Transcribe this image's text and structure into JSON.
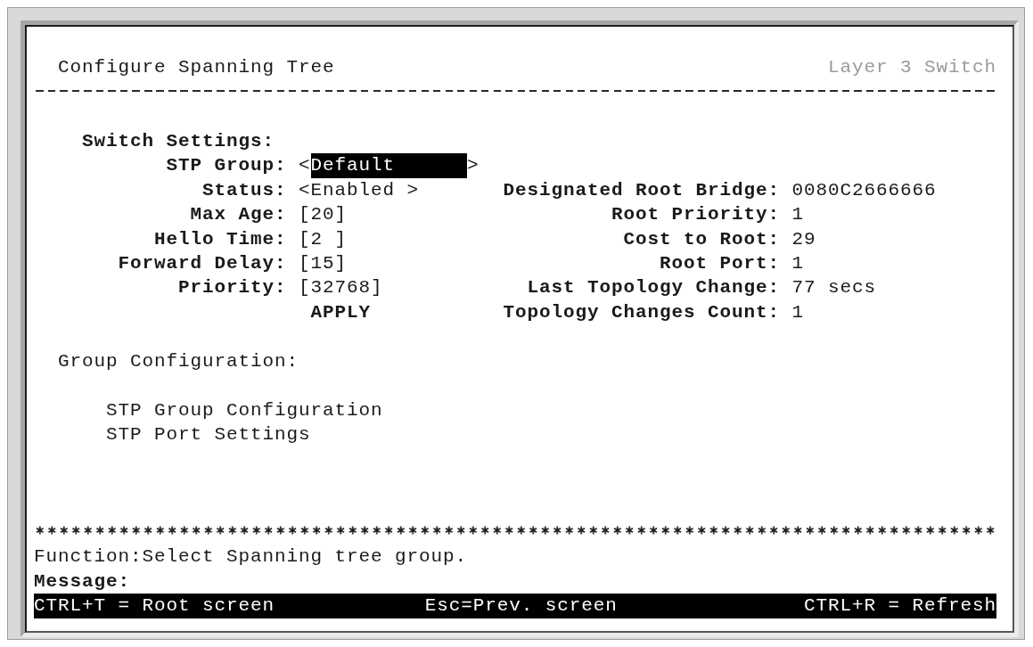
{
  "header": {
    "title": "Configure Spanning Tree",
    "device": "Layer 3 Switch"
  },
  "switch_settings": {
    "heading": "Switch Settings:",
    "fields": [
      {
        "label": "STP Group:",
        "kind": "select",
        "open": "<",
        "value": "Default",
        "close": ">",
        "focused": true
      },
      {
        "label": "Status:",
        "kind": "select",
        "open": "<",
        "value": "Enabled",
        "close": ">",
        "focused": false
      },
      {
        "label": "Max Age:",
        "kind": "input",
        "open": "[",
        "value": "20",
        "close": "]",
        "focused": false
      },
      {
        "label": "Hello Time:",
        "kind": "input",
        "open": "[",
        "value": "2",
        "close": "]",
        "focused": false
      },
      {
        "label": "Forward Delay:",
        "kind": "input",
        "open": "[",
        "value": "15",
        "close": "]",
        "focused": false
      },
      {
        "label": "Priority:",
        "kind": "input",
        "open": "[",
        "value": "32768",
        "close": "]",
        "focused": false
      }
    ],
    "apply_button": "APPLY"
  },
  "bridge_status": [
    {
      "label": "Designated Root Bridge:",
      "value": "0080C2666666"
    },
    {
      "label": "Root Priority:",
      "value": "1"
    },
    {
      "label": "Cost to Root:",
      "value": "29"
    },
    {
      "label": "Root Port:",
      "value": "1"
    },
    {
      "label": "Last Topology Change:",
      "value": "77 secs"
    },
    {
      "label": "Topology Changes Count:",
      "value": "1"
    }
  ],
  "group_configuration": {
    "heading": "Group Configuration:",
    "items": [
      "STP Group Configuration",
      "STP Port Settings"
    ]
  },
  "footer": {
    "function_line": "Function:Select Spanning tree group.",
    "message_label": "Message:"
  },
  "key_bar": [
    "CTRL+T = Root screen",
    "Esc=Prev. screen",
    "CTRL+R = Refresh"
  ]
}
